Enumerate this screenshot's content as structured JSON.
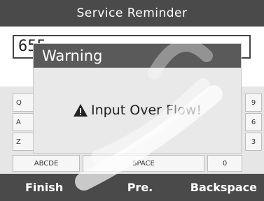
{
  "title": "Service Reminder",
  "input_value": "655",
  "keyboard": {
    "left_keys": [
      "Q",
      "A",
      "Z"
    ],
    "right_keys": [
      "9",
      "6",
      "3"
    ],
    "bottom_left": "ABCDE",
    "space": "SPACE",
    "zero": "0"
  },
  "dialog": {
    "title": "Warning",
    "message": "Input Over Flow!"
  },
  "bottom_bar": {
    "finish": "Finish",
    "previous": "Pre.",
    "backspace": "Backspace"
  }
}
